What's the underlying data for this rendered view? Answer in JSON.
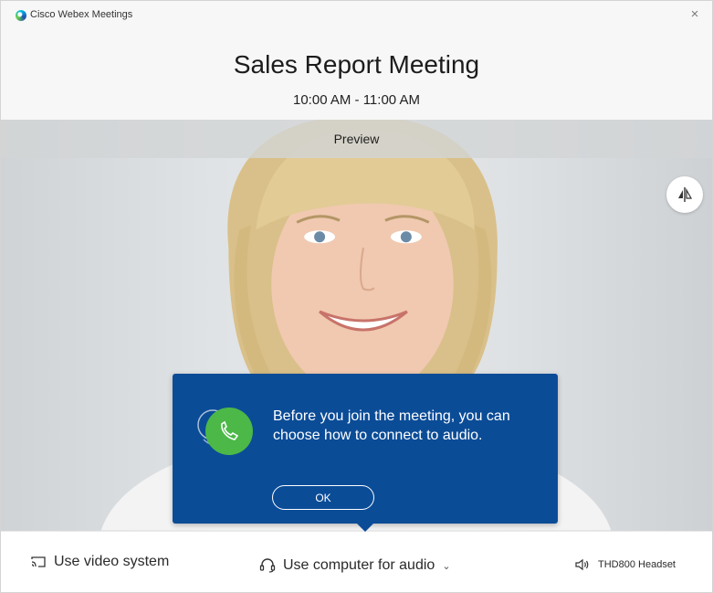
{
  "window": {
    "app_title": "Cisco Webex Meetings",
    "close_glyph": "×"
  },
  "meeting": {
    "title": "Sales Report Meeting",
    "time": "10:00 AM - 11:00 AM"
  },
  "preview": {
    "label": "Preview",
    "mirror_icon": "mirror-flip-icon"
  },
  "tooltip": {
    "message": "Before you join the meeting, you can choose how to connect to audio.",
    "ok_label": "OK",
    "icon": "phone-icon"
  },
  "bottombar": {
    "video_system_label": "Use video system",
    "audio_label": "Use computer for audio",
    "audio_chevron": "⌄",
    "headset_label": "THD800 Headset"
  },
  "colors": {
    "tooltip_bg": "#0b4c97",
    "phone_green": "#4cb848",
    "logo_blue": "#00bceb"
  }
}
